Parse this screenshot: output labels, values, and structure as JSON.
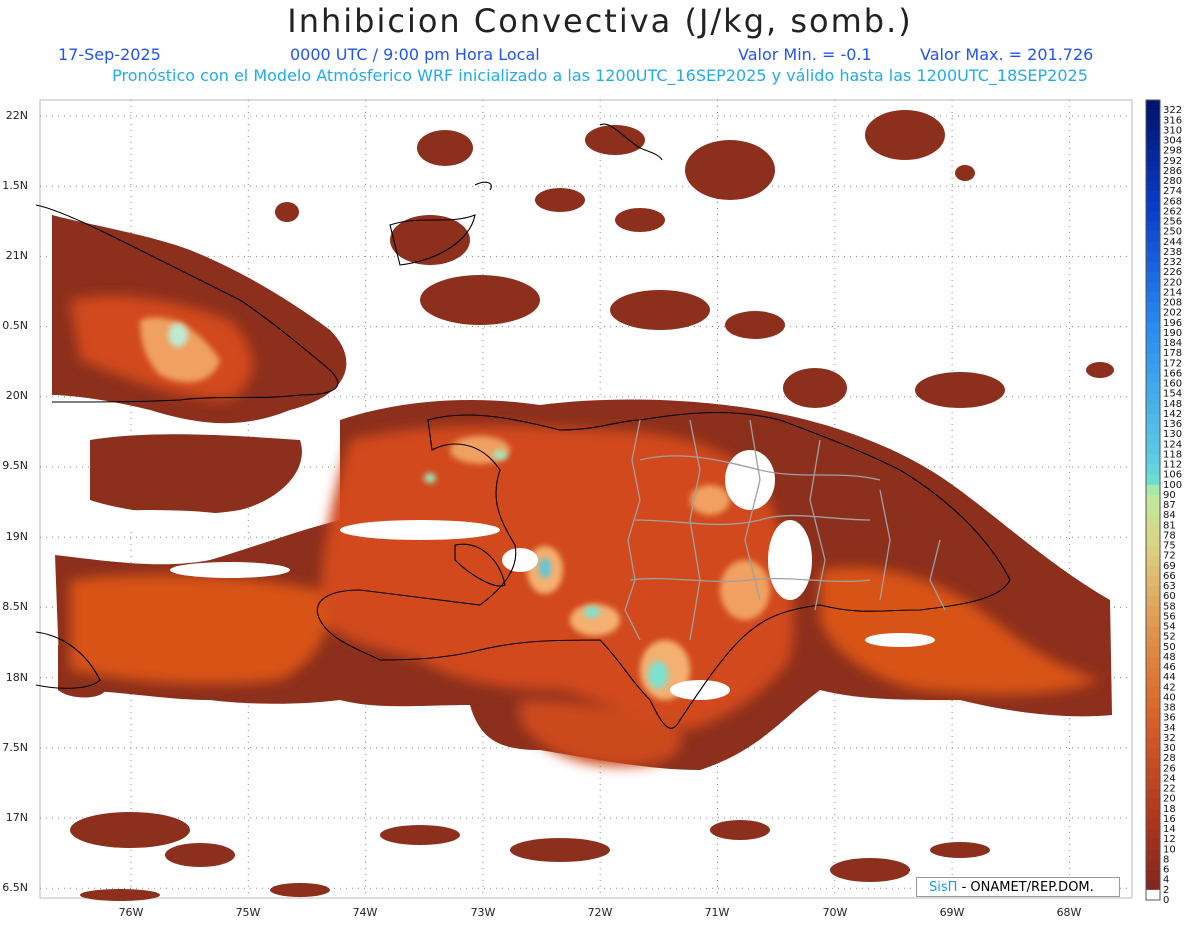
{
  "header": {
    "title": "Inhibicion Convectiva (J/kg, somb.)",
    "date": "17-Sep-2025",
    "time": "0000 UTC / 9:00 pm Hora Local",
    "min_label": "Valor Min. = -0.1",
    "max_label": "Valor Max. = 201.726",
    "subtitle": "Pronóstico con el Modelo Atmósferico WRF inicializado a las 1200UTC_16SEP2025 y válido hasta las  1200UTC_18SEP2025"
  },
  "axes": {
    "lat_labels": [
      "22N",
      "1.5N",
      "21N",
      "0.5N",
      "20N",
      "9.5N",
      "19N",
      "8.5N",
      "18N",
      "7.5N",
      "17N",
      "6.5N"
    ],
    "lon_labels": [
      "76W",
      "75W",
      "74W",
      "73W",
      "72W",
      "71W",
      "70W",
      "69W",
      "68W"
    ]
  },
  "legend": {
    "values": [
      "322",
      "316",
      "310",
      "304",
      "298",
      "292",
      "286",
      "280",
      "274",
      "268",
      "262",
      "256",
      "250",
      "244",
      "238",
      "232",
      "226",
      "220",
      "214",
      "208",
      "202",
      "196",
      "190",
      "184",
      "178",
      "172",
      "166",
      "160",
      "154",
      "148",
      "142",
      "136",
      "130",
      "124",
      "118",
      "112",
      "106",
      "100",
      "90",
      "87",
      "84",
      "81",
      "78",
      "75",
      "72",
      "69",
      "66",
      "63",
      "60",
      "58",
      "56",
      "54",
      "52",
      "50",
      "48",
      "46",
      "44",
      "42",
      "40",
      "38",
      "36",
      "34",
      "32",
      "30",
      "28",
      "26",
      "24",
      "22",
      "20",
      "18",
      "16",
      "14",
      "12",
      "10",
      "8",
      "6",
      "4",
      "2",
      "0"
    ]
  },
  "credit": {
    "brand": "SisΠ",
    "text": "- ONAMET/REP.DOM."
  },
  "colors": {
    "base": "#8c2f1c",
    "orange": "#e0561a",
    "cyan": "#7fe0d0",
    "border_country": "#000000",
    "border_province": "#a0a0a0"
  }
}
